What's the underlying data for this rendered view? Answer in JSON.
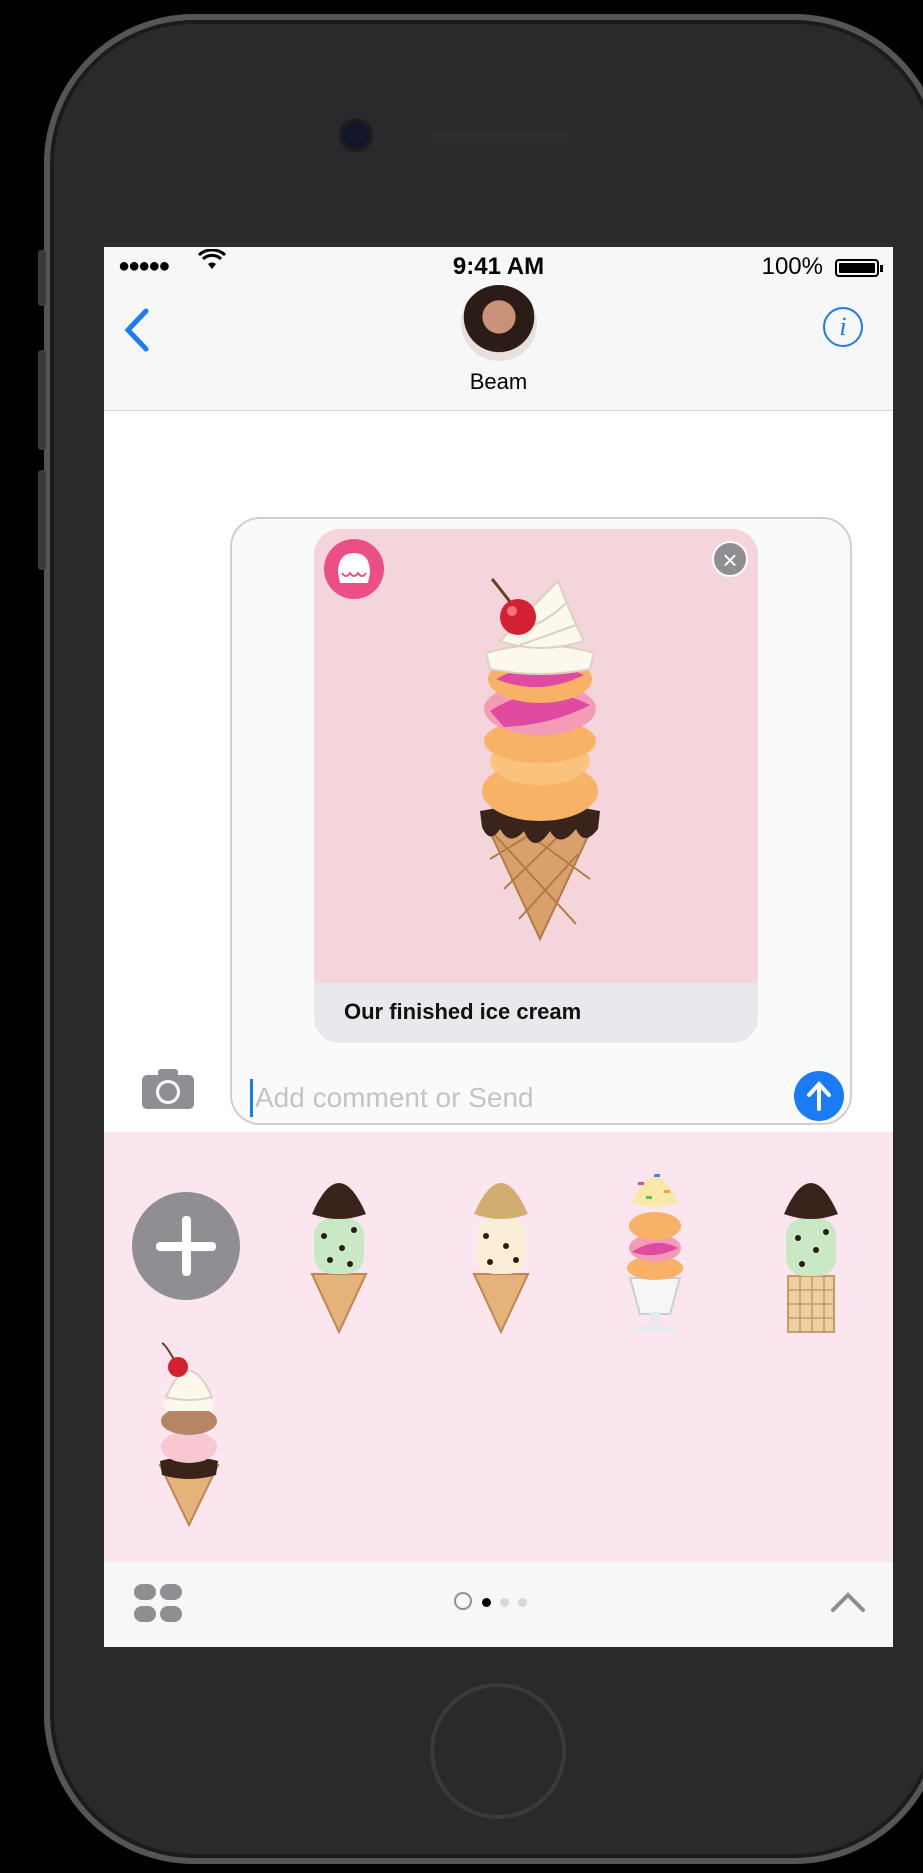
{
  "status_bar": {
    "time": "9:41 AM",
    "battery": "100%",
    "signal": "●●●●●",
    "wifi": "wifi"
  },
  "nav": {
    "contact_name": "Beam",
    "back_icon": "chevron-left-icon",
    "info_icon": "info-icon",
    "info_glyph": "i"
  },
  "message_card": {
    "caption": "Our finished ice cream",
    "close_glyph": "×"
  },
  "compose": {
    "placeholder": "Add comment or Send"
  },
  "drawer": {
    "add_icon": "plus-icon",
    "stickers": [
      "mint-chocolate-chip-cone",
      "cookie-dough-cone",
      "rainbow-sprinkles-sundae",
      "mint-chip-waffle-cone",
      "neapolitan-cone"
    ]
  },
  "toolbar": {
    "apps_icon": "app-drawer-icon",
    "page_count": 3,
    "active_page": 1,
    "expand_icon": "chevron-up-icon"
  },
  "colors": {
    "accent": "#1a7bf5",
    "drawer_bg": "#fbe6ef",
    "card_bg": "#f3d5db"
  }
}
